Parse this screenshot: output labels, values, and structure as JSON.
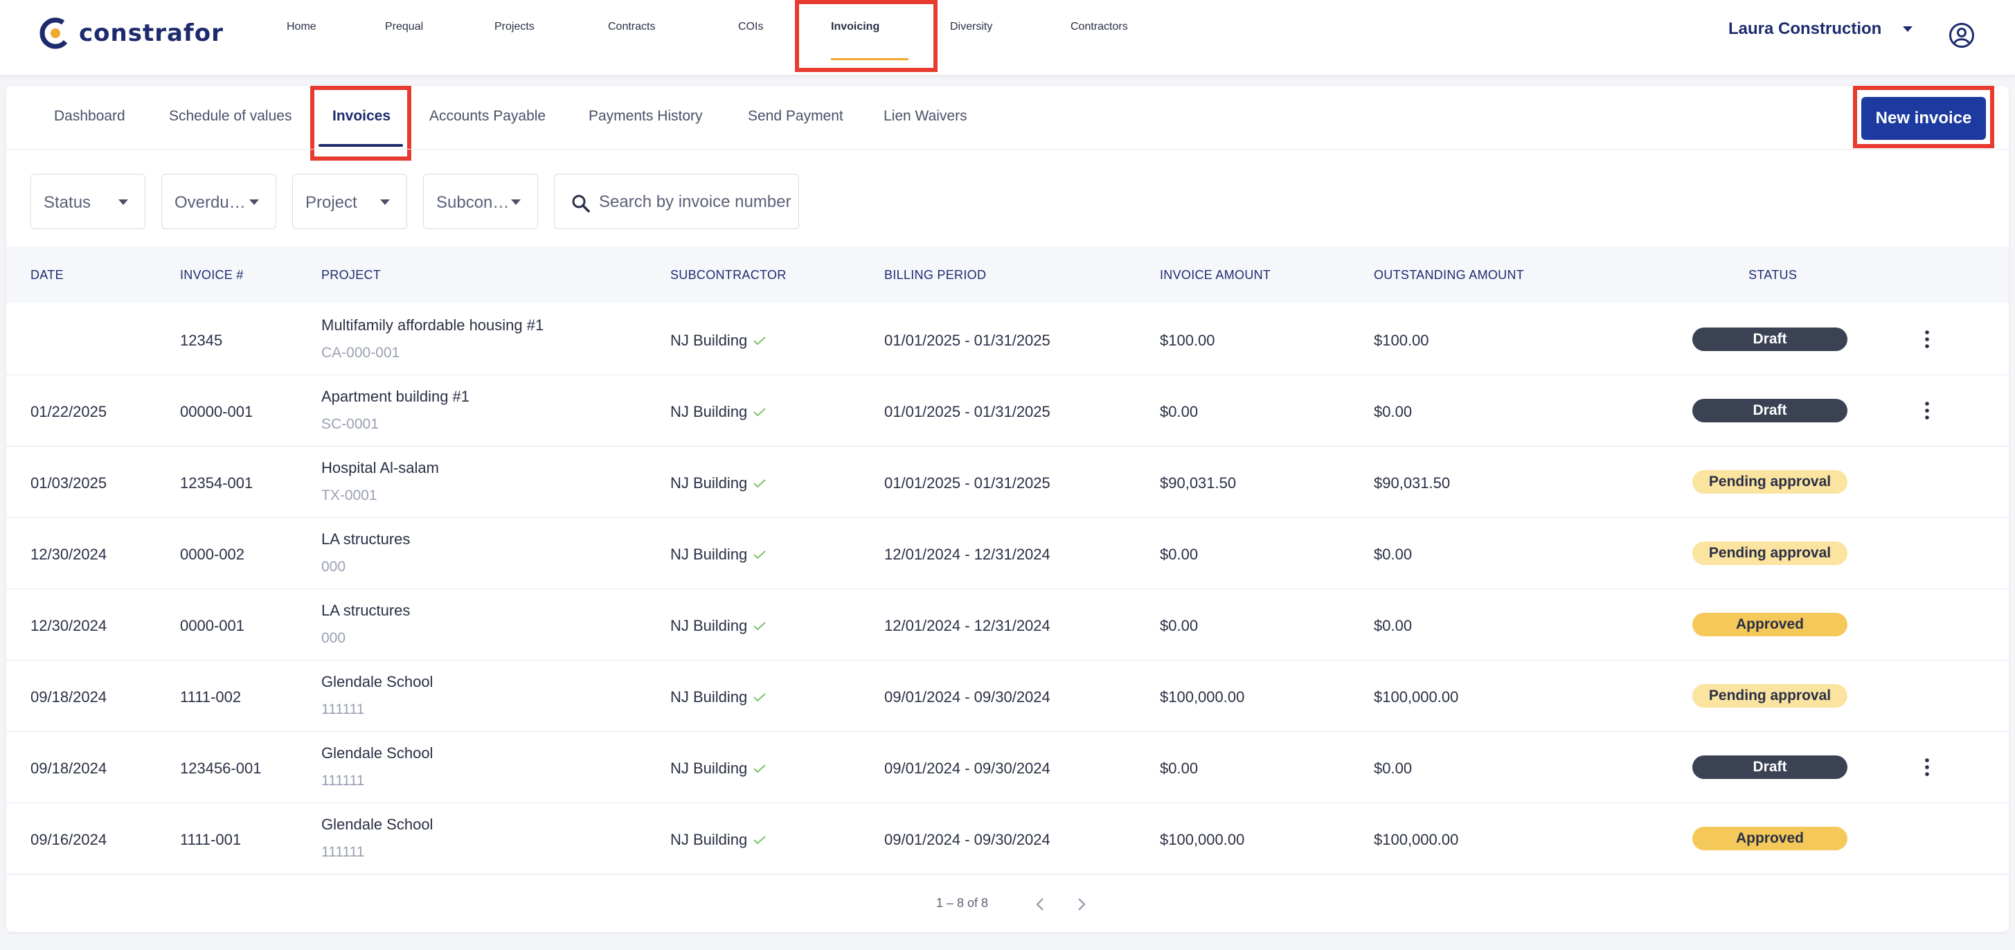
{
  "app": {
    "logo_text": "constrafor"
  },
  "nav": {
    "items": [
      "Home",
      "Prequal",
      "Projects",
      "Contracts",
      "COIs",
      "Invoicing",
      "Diversity",
      "Contractors"
    ],
    "active": "Invoicing",
    "account": "Laura Construction"
  },
  "subnav": {
    "items": [
      "Dashboard",
      "Schedule of values",
      "Invoices",
      "Accounts Payable",
      "Payments History",
      "Send Payment",
      "Lien Waivers"
    ],
    "active": "Invoices",
    "new_invoice_label": "New invoice"
  },
  "filters": {
    "status": "Status",
    "overdue": "Overdu…",
    "project": "Project",
    "subcontractor": "Subcon…",
    "search_placeholder": "Search by invoice number"
  },
  "table": {
    "headers": [
      "DATE",
      "INVOICE #",
      "PROJECT",
      "SUBCONTRACTOR",
      "BILLING PERIOD",
      "INVOICE AMOUNT",
      "OUTSTANDING AMOUNT",
      "STATUS"
    ],
    "rows": [
      {
        "date": "",
        "invoice": "12345",
        "project": "Multifamily affordable housing #1",
        "project_code": "CA-000-001",
        "subcontractor": "NJ Building",
        "billing_period": "01/01/2025 - 01/31/2025",
        "invoice_amount": "$100.00",
        "outstanding_amount": "$100.00",
        "status": "Draft"
      },
      {
        "date": "01/22/2025",
        "invoice": "00000-001",
        "project": "Apartment building #1",
        "project_code": "SC-0001",
        "subcontractor": "NJ Building",
        "billing_period": "01/01/2025 - 01/31/2025",
        "invoice_amount": "$0.00",
        "outstanding_amount": "$0.00",
        "status": "Draft"
      },
      {
        "date": "01/03/2025",
        "invoice": "12354-001",
        "project": "Hospital Al-salam",
        "project_code": "TX-0001",
        "subcontractor": "NJ Building",
        "billing_period": "01/01/2025 - 01/31/2025",
        "invoice_amount": "$90,031.50",
        "outstanding_amount": "$90,031.50",
        "status": "Pending approval"
      },
      {
        "date": "12/30/2024",
        "invoice": "0000-002",
        "project": "LA structures",
        "project_code": "000",
        "subcontractor": "NJ Building",
        "billing_period": "12/01/2024 - 12/31/2024",
        "invoice_amount": "$0.00",
        "outstanding_amount": "$0.00",
        "status": "Pending approval"
      },
      {
        "date": "12/30/2024",
        "invoice": "0000-001",
        "project": "LA structures",
        "project_code": "000",
        "subcontractor": "NJ Building",
        "billing_period": "12/01/2024 - 12/31/2024",
        "invoice_amount": "$0.00",
        "outstanding_amount": "$0.00",
        "status": "Approved"
      },
      {
        "date": "09/18/2024",
        "invoice": "1111-002",
        "project": "Glendale School",
        "project_code": "111111",
        "subcontractor": "NJ Building",
        "billing_period": "09/01/2024 - 09/30/2024",
        "invoice_amount": "$100,000.00",
        "outstanding_amount": "$100,000.00",
        "status": "Pending approval"
      },
      {
        "date": "09/18/2024",
        "invoice": "123456-001",
        "project": "Glendale School",
        "project_code": "111111",
        "subcontractor": "NJ Building",
        "billing_period": "09/01/2024 - 09/30/2024",
        "invoice_amount": "$0.00",
        "outstanding_amount": "$0.00",
        "status": "Draft"
      },
      {
        "date": "09/16/2024",
        "invoice": "1111-001",
        "project": "Glendale School",
        "project_code": "111111",
        "subcontractor": "NJ Building",
        "billing_period": "09/01/2024 - 09/30/2024",
        "invoice_amount": "$100,000.00",
        "outstanding_amount": "$100,000.00",
        "status": "Approved"
      }
    ]
  },
  "pagination": {
    "label": "1 – 8 of 8"
  },
  "colors": {
    "brand_navy": "#1d2b6e",
    "primary_button": "#1c3aa0",
    "accent_orange": "#f0a92e",
    "highlight_red": "#e63b2e",
    "draft_badge": "#3a4254",
    "pending_badge": "#fbe3a0",
    "approved_badge": "#f4c95a",
    "check_green": "#7cc36a"
  },
  "icons": [
    "logo-icon",
    "chevron-down-icon",
    "user-account-icon",
    "search-icon",
    "check-icon",
    "more-vertical-icon",
    "chevron-left-icon",
    "chevron-right-icon"
  ]
}
